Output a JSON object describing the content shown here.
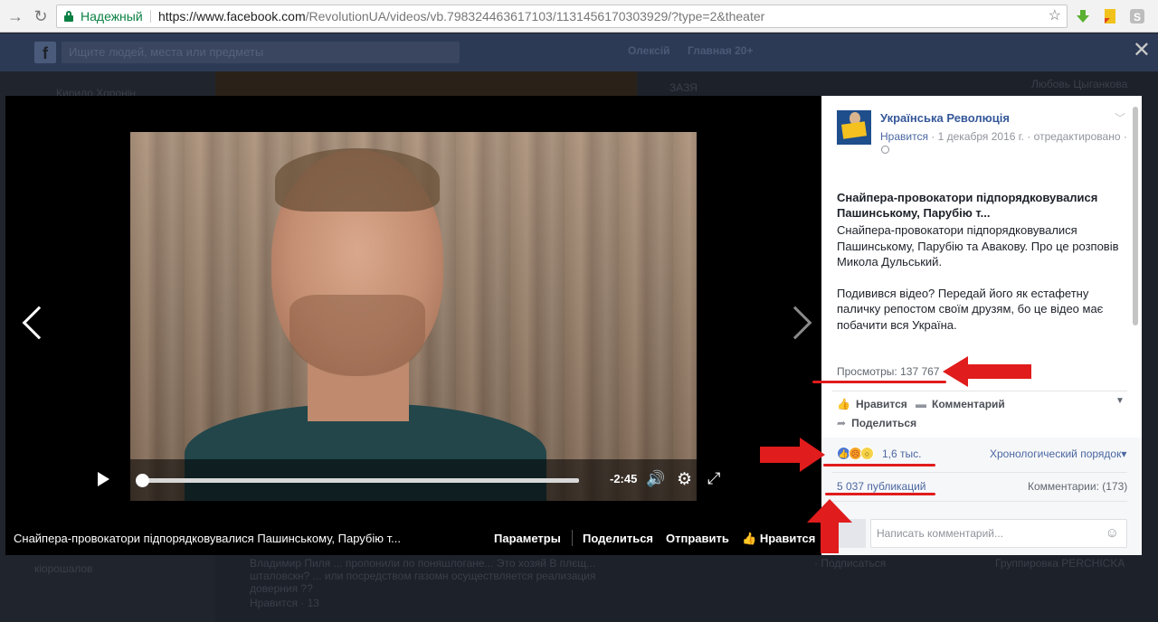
{
  "browser": {
    "secure_label": "Надежный",
    "url_host": "https://www.facebook.com",
    "url_rest": "/RevolutionUA/videos/vb.798324463617103/1131456170303929/?type=2&theater"
  },
  "fb_bar": {
    "search_placeholder": "Ищите людей, места или предметы",
    "nav_1": "Олексій",
    "nav_2": "Главная 20+"
  },
  "background": {
    "left_name": "Кирило Хоронін",
    "right_name": "Любовь Цыганкова",
    "left_bottom": "кіорошалов",
    "comment_lines": [
      "Владимир Пиля ... пропонили по поняшлогане... Это хозяй В плєщ...",
      "шталовскн? ... или посредством газомн осуществляется реализация",
      "доверния ??",
      "Нравится · 13"
    ],
    "right_lines": [
      "· Подписаться",
      "Группировка PERCHICKA"
    ],
    "small_top": "ЗАЗЯ"
  },
  "video": {
    "time_remaining": "-2:45",
    "progress": 0.01,
    "caption": "Снайпера-провокатори підпорядковувалися Пашинському, Парубію т...",
    "actions": {
      "params": "Параметры",
      "share": "Поделиться",
      "send": "Отправить",
      "like": "Нравится"
    }
  },
  "post": {
    "page_name": "Українська Революція",
    "like_link": "Нравится",
    "meta": "· 1 декабря 2016 г. · отредактировано ·",
    "title": "Снайпера-провокатори підпорядковувалися Пашинському, Парубію т...",
    "body_1": "Снайпера-провокатори підпорядковувалися Пашинському, Парубію та Авакову. Про це розповів Микола Дульський.",
    "body_2": "Подивився відео? Передай його як естафетну паличку репостом своїм друзям, бо це відео має побачити вся Україна.",
    "views": "Просмотры: 137 767",
    "action_like": "Нравится",
    "action_comment": "Комментарий",
    "action_share": "Поделиться",
    "reaction_count": "1,6 тыс.",
    "order": "Хронологический порядок",
    "shares": "5 037 публикаций",
    "comments": "Комментарии: (173)",
    "comment_placeholder": "Написать комментарий..."
  },
  "colors": {
    "accent": "#365899",
    "annotation_red": "#e01c1c",
    "secure_green": "#0b8043"
  }
}
